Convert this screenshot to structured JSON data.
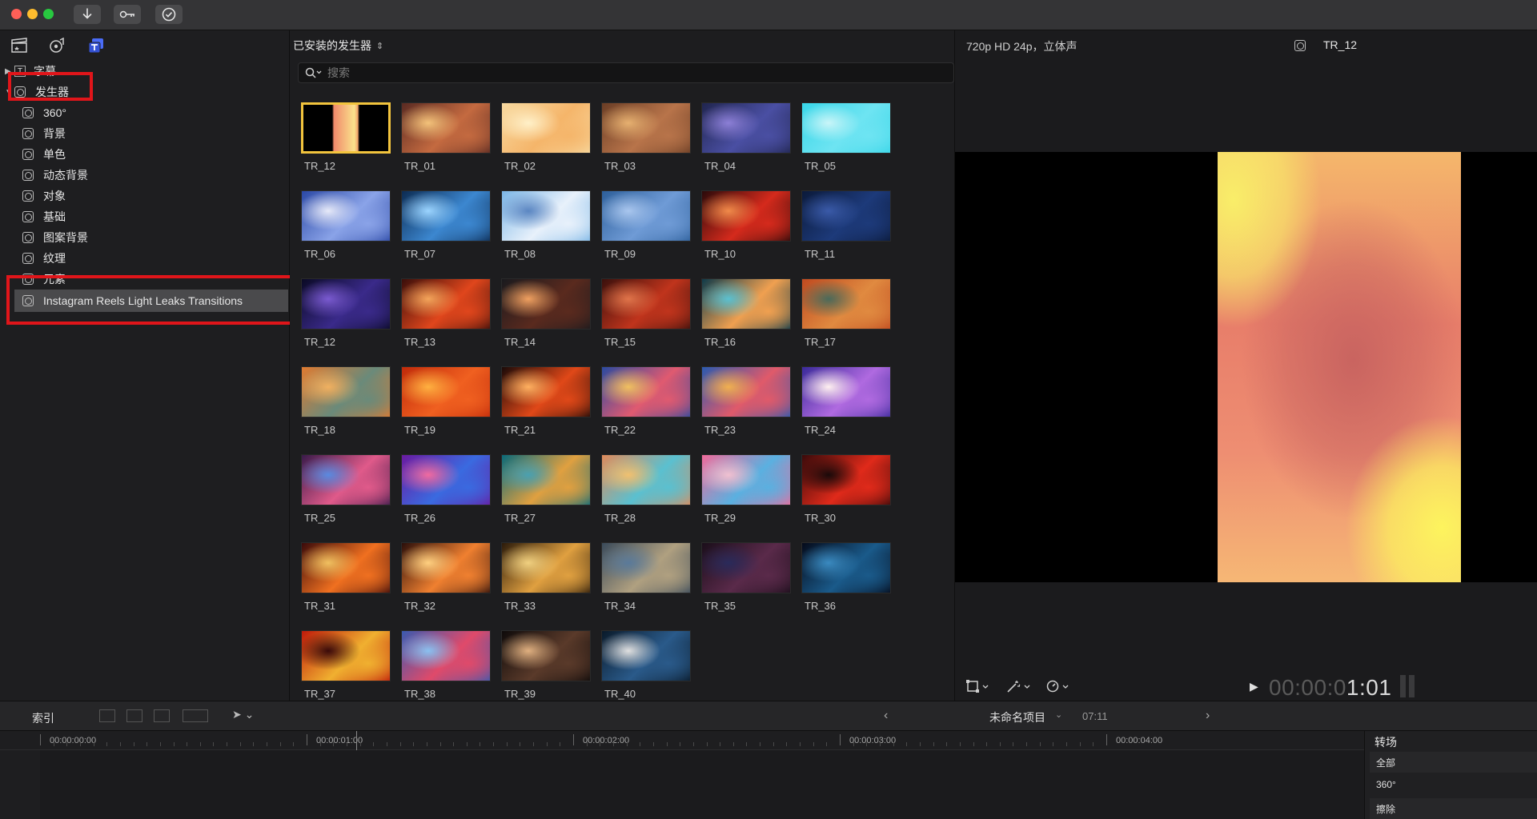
{
  "toolbar": {
    "import_icon": "download-arrow",
    "keywords_icon": "key",
    "check_icon": "checkmark-circle"
  },
  "sidebar": {
    "tabs": [
      "media-library-icon",
      "audio-icon",
      "titles-generators-icon"
    ],
    "items": [
      {
        "label": "字幕",
        "level": 0,
        "icon": "titles-icon"
      },
      {
        "label": "发生器",
        "level": 0,
        "icon": "generator-icon"
      },
      {
        "label": "360°",
        "level": 1,
        "icon": "generator-icon"
      },
      {
        "label": "背景",
        "level": 1,
        "icon": "generator-icon"
      },
      {
        "label": "单色",
        "level": 1,
        "icon": "generator-icon"
      },
      {
        "label": "动态背景",
        "level": 1,
        "icon": "generator-icon"
      },
      {
        "label": "对象",
        "level": 1,
        "icon": "generator-icon"
      },
      {
        "label": "基础",
        "level": 1,
        "icon": "generator-icon"
      },
      {
        "label": "图案背景",
        "level": 1,
        "icon": "generator-icon"
      },
      {
        "label": "纹理",
        "level": 1,
        "icon": "generator-icon"
      },
      {
        "label": "元素",
        "level": 1,
        "icon": "generator-icon"
      },
      {
        "label": "Instagram Reels Light Leaks Transitions",
        "level": 1,
        "icon": "generator-icon",
        "selected": true
      }
    ]
  },
  "browser": {
    "title": "已安装的发生器",
    "search_placeholder": "搜索",
    "clips": [
      "TR_12",
      "TR_01",
      "TR_02",
      "TR_03",
      "TR_04",
      "TR_05",
      "TR_06",
      "TR_07",
      "TR_08",
      "TR_09",
      "TR_10",
      "TR_11",
      "TR_12",
      "TR_13",
      "TR_14",
      "TR_15",
      "TR_16",
      "TR_17",
      "TR_18",
      "TR_19",
      "TR_21",
      "TR_22",
      "TR_23",
      "TR_24",
      "TR_25",
      "TR_26",
      "TR_27",
      "TR_28",
      "TR_29",
      "TR_30",
      "TR_31",
      "TR_32",
      "TR_33",
      "TR_34",
      "TR_35",
      "TR_36",
      "TR_37",
      "TR_38",
      "TR_39",
      "TR_40"
    ],
    "selected_index": 0
  },
  "viewer": {
    "format": "720p HD 24p，立体声",
    "clip_name": "TR_12",
    "timecode_dim": "00:00:0",
    "timecode_lit": "1:01"
  },
  "timeline": {
    "index_label": "索引",
    "project_name": "未命名项目",
    "duration": "07:11",
    "ruler": [
      "00:00:00:00",
      "00:00:01:00",
      "00:00:02:00",
      "00:00:03:00",
      "00:00:04:00"
    ]
  },
  "transitions": {
    "title": "转场",
    "items": [
      "全部",
      "360°",
      "擦除"
    ]
  },
  "colors": {
    "accent_yellow": "#f2c43d",
    "highlight_red": "#e0151a",
    "selected_row": "#4a4a4c",
    "bg": "#1c1c1e"
  }
}
